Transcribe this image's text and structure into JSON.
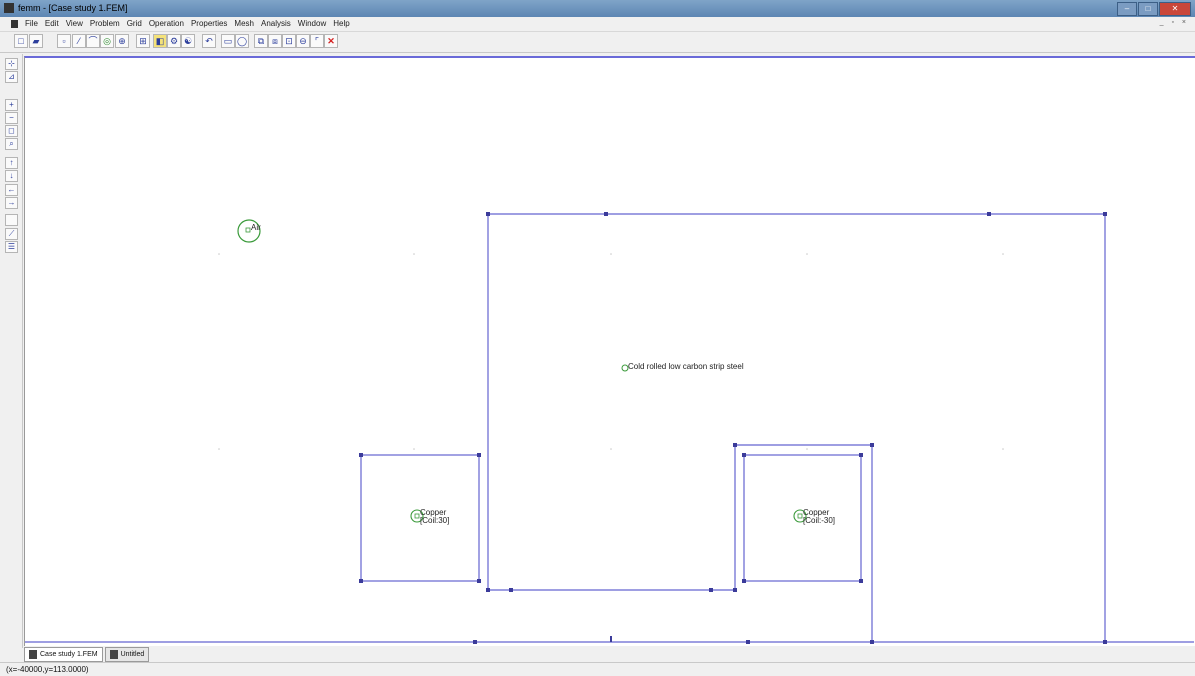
{
  "window": {
    "title": "femm - [Case study 1.FEM]",
    "controls": {
      "minimize": "–",
      "maximize": "□",
      "close": "✕"
    }
  },
  "menu": {
    "items": [
      "File",
      "Edit",
      "View",
      "Problem",
      "Grid",
      "Operation",
      "Properties",
      "Mesh",
      "Analysis",
      "Window",
      "Help"
    ],
    "mdi_controls": "_ ▫ ×"
  },
  "toolbar": {
    "buttons": [
      {
        "name": "new",
        "glyph": "□"
      },
      {
        "name": "open",
        "glyph": "▰"
      },
      {
        "name": "node-mode",
        "glyph": "▫"
      },
      {
        "name": "segment-mode",
        "glyph": "⁄"
      },
      {
        "name": "arc-mode",
        "glyph": "⌒"
      },
      {
        "name": "block-label-mode",
        "glyph": "◎"
      },
      {
        "name": "group-mode",
        "glyph": "⊕"
      },
      {
        "name": "grid-settings",
        "glyph": "⊞"
      },
      {
        "name": "mesh",
        "glyph": "◧"
      },
      {
        "name": "run-analysis",
        "glyph": "⚙"
      },
      {
        "name": "view-results",
        "glyph": "☯"
      },
      {
        "name": "undo",
        "glyph": "↶"
      },
      {
        "name": "zoom-box",
        "glyph": "▭"
      },
      {
        "name": "zoom-circle",
        "glyph": "◯"
      },
      {
        "name": "copy",
        "glyph": "⧉"
      },
      {
        "name": "move",
        "glyph": "⧈"
      },
      {
        "name": "scale",
        "glyph": "⊡"
      },
      {
        "name": "mirror",
        "glyph": "⊖"
      },
      {
        "name": "fillet",
        "glyph": "⌜"
      },
      {
        "name": "delete",
        "glyph": "✕"
      }
    ]
  },
  "left_toolbar": {
    "buttons": [
      {
        "name": "snap-grid",
        "glyph": "⊹"
      },
      {
        "name": "show-grid",
        "glyph": "⊿"
      },
      {
        "name": "zoom-in",
        "glyph": "+"
      },
      {
        "name": "zoom-out",
        "glyph": "−"
      },
      {
        "name": "zoom-natural",
        "glyph": "◻"
      },
      {
        "name": "zoom-window",
        "glyph": "⌕"
      },
      {
        "name": "pan-up",
        "glyph": "↑"
      },
      {
        "name": "pan-down",
        "glyph": "↓"
      },
      {
        "name": "pan-left",
        "glyph": "←"
      },
      {
        "name": "pan-right",
        "glyph": "→"
      },
      {
        "name": "blank",
        "glyph": ""
      },
      {
        "name": "measure",
        "glyph": "⟋"
      },
      {
        "name": "props",
        "glyph": "☰"
      }
    ]
  },
  "canvas": {
    "block_labels": [
      {
        "name": "air",
        "text": "Air"
      },
      {
        "name": "steel",
        "text": "Cold rolled low carbon strip steel"
      },
      {
        "name": "copper-left",
        "line1": "Copper",
        "line2": "[Coil:30]"
      },
      {
        "name": "copper-right",
        "line1": "Copper",
        "line2": "[Coil:-30]"
      }
    ]
  },
  "tabs": [
    {
      "name": "case-study",
      "label": "Case study 1.FEM",
      "active": true
    },
    {
      "name": "untitled",
      "label": "Untitled",
      "active": false
    }
  ],
  "status": {
    "coords": "(x=-40000,y=113.0000)"
  },
  "colors": {
    "geometry": "#6464d0",
    "label_marker": "#3a9a3a",
    "title_gradient": "#6e96c0"
  }
}
